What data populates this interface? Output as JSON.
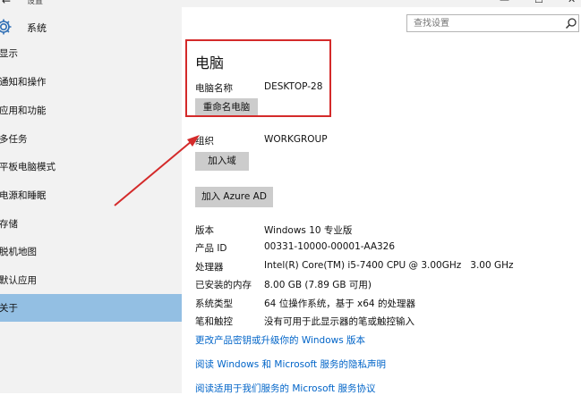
{
  "window": {
    "title": "设置",
    "back_glyph": "←",
    "minimize_glyph": "—",
    "maximize_glyph": "☐",
    "close_glyph": "✕"
  },
  "sidebar": {
    "header": "系统",
    "items": [
      {
        "label": "显示"
      },
      {
        "label": "通知和操作"
      },
      {
        "label": "应用和功能"
      },
      {
        "label": "多任务"
      },
      {
        "label": "平板电脑模式"
      },
      {
        "label": "电源和睡眠"
      },
      {
        "label": "存储"
      },
      {
        "label": "脱机地图"
      },
      {
        "label": "默认应用"
      },
      {
        "label": "关于",
        "active": true
      }
    ]
  },
  "search": {
    "placeholder": "查找设置",
    "icon": "search-icon"
  },
  "main": {
    "heading": "电脑",
    "pc_name_label": "电脑名称",
    "pc_name_value": "DESKTOP-28",
    "rename_button": "重命名电脑",
    "org_label": "组织",
    "org_value": "WORKGROUP",
    "join_domain_button": "加入域",
    "join_azure_button": "加入 Azure AD",
    "specs": [
      {
        "label": "版本",
        "value": "Windows 10 专业版"
      },
      {
        "label": "产品 ID",
        "value": "00331-10000-00001-AA326"
      },
      {
        "label": "处理器",
        "value": "Intel(R) Core(TM) i5-7400 CPU @ 3.00GHz   3.00 GHz"
      },
      {
        "label": "已安装的内存",
        "value": "8.00 GB (7.89 GB 可用)"
      },
      {
        "label": "系统类型",
        "value": "64 位操作系统，基于 x64 的处理器"
      },
      {
        "label": "笔和触控",
        "value": "没有可用于此显示器的笔或触控输入"
      }
    ],
    "links": [
      "更改产品密钥或升级你的 Windows 版本",
      "阅读 Windows 和 Microsoft 服务的隐私声明",
      "阅读适用于我们服务的 Microsoft 服务协议"
    ]
  },
  "annotation": {
    "color": "#d42a2a"
  }
}
